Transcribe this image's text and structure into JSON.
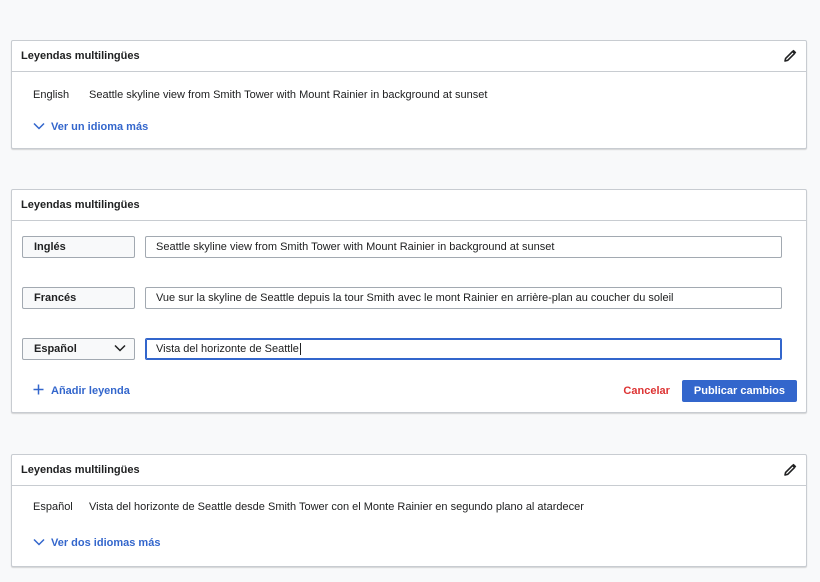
{
  "panel1": {
    "title": "Leyendas multilingües",
    "edit_icon": "pencil-icon",
    "caption": {
      "language": "English",
      "text": "Seattle skyline view from Smith Tower with Mount Rainier in background at sunset"
    },
    "toggle_label": "Ver un idioma más"
  },
  "panel2": {
    "title": "Leyendas multilingües",
    "rows": [
      {
        "language": "Inglés",
        "value": "Seattle skyline view from Smith Tower with Mount Rainier in background at sunset"
      },
      {
        "language": "Francés",
        "value": "Vue sur la skyline de Seattle depuis la tour Smith avec le mont Rainier en arrière-plan au coucher du soleil"
      },
      {
        "language": "Español",
        "value": "Vista del horizonte de Seattle"
      }
    ],
    "add_label": "Añadir leyenda",
    "cancel_label": "Cancelar",
    "publish_label": "Publicar cambios"
  },
  "panel3": {
    "title": "Leyendas multilingües",
    "edit_icon": "pencil-icon",
    "caption": {
      "language": "Español",
      "text": "Vista del horizonte de Seattle desde Smith Tower con el Monte Rainier en segundo plano al atardecer"
    },
    "toggle_label": "Ver dos idiomas más"
  },
  "colors": {
    "link": "#3366cc",
    "destructive": "#d33333",
    "border": "#c8ccd1",
    "background": "#f8f9fa"
  }
}
